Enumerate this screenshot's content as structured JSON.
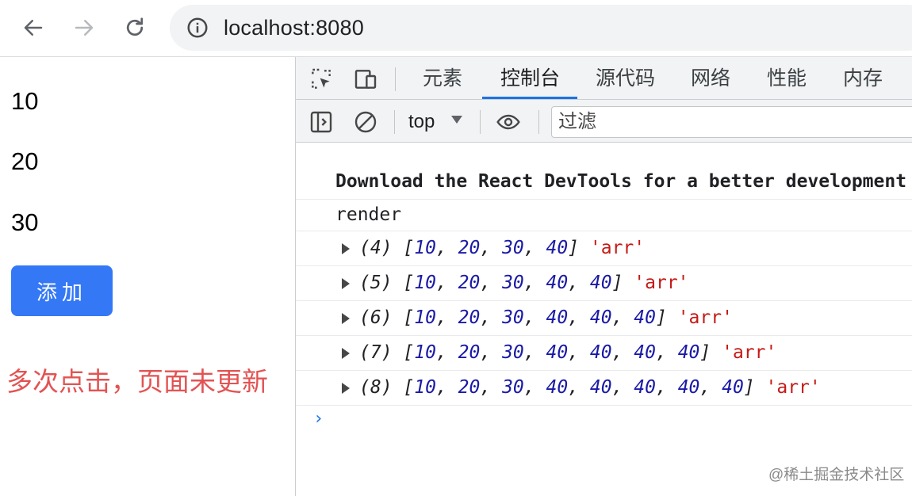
{
  "browser": {
    "url": "localhost:8080"
  },
  "page": {
    "items": [
      "10",
      "20",
      "30"
    ],
    "add_button_label": "添加",
    "annotation": "多次点击，页面未更新"
  },
  "devtools": {
    "tabs": [
      {
        "label": "元素",
        "active": false
      },
      {
        "label": "控制台",
        "active": true
      },
      {
        "label": "源代码",
        "active": false
      },
      {
        "label": "网络",
        "active": false
      },
      {
        "label": "性能",
        "active": false
      },
      {
        "label": "内存",
        "active": false
      }
    ],
    "context": "top",
    "filter_placeholder": "过滤",
    "console": {
      "banner": "Download the React DevTools for a better development experience",
      "render_log": "render",
      "logs": [
        {
          "count": "(4)",
          "values": [
            "10",
            "20",
            "30",
            "40"
          ],
          "label": "'arr'"
        },
        {
          "count": "(5)",
          "values": [
            "10",
            "20",
            "30",
            "40",
            "40"
          ],
          "label": "'arr'"
        },
        {
          "count": "(6)",
          "values": [
            "10",
            "20",
            "30",
            "40",
            "40",
            "40"
          ],
          "label": "'arr'"
        },
        {
          "count": "(7)",
          "values": [
            "10",
            "20",
            "30",
            "40",
            "40",
            "40",
            "40"
          ],
          "label": "'arr'"
        },
        {
          "count": "(8)",
          "values": [
            "10",
            "20",
            "30",
            "40",
            "40",
            "40",
            "40",
            "40"
          ],
          "label": "'arr'"
        }
      ]
    }
  },
  "watermark": "@稀土掘金技术社区",
  "icons": {
    "back": "arrow-left-icon",
    "forward": "arrow-right-icon",
    "reload": "reload-icon",
    "info": "info-icon",
    "inspect": "inspect-element-icon",
    "device": "device-toolbar-icon",
    "sidebar": "sidebar-toggle-icon",
    "clear": "clear-console-icon",
    "eye": "eye-icon",
    "prompt": "chevron-right-icon"
  },
  "colors": {
    "primary_button": "#3478f6",
    "annotation": "#e35353",
    "active_tab": "#1a73e8",
    "string": "#c41a16",
    "number": "#1a1aa6"
  }
}
